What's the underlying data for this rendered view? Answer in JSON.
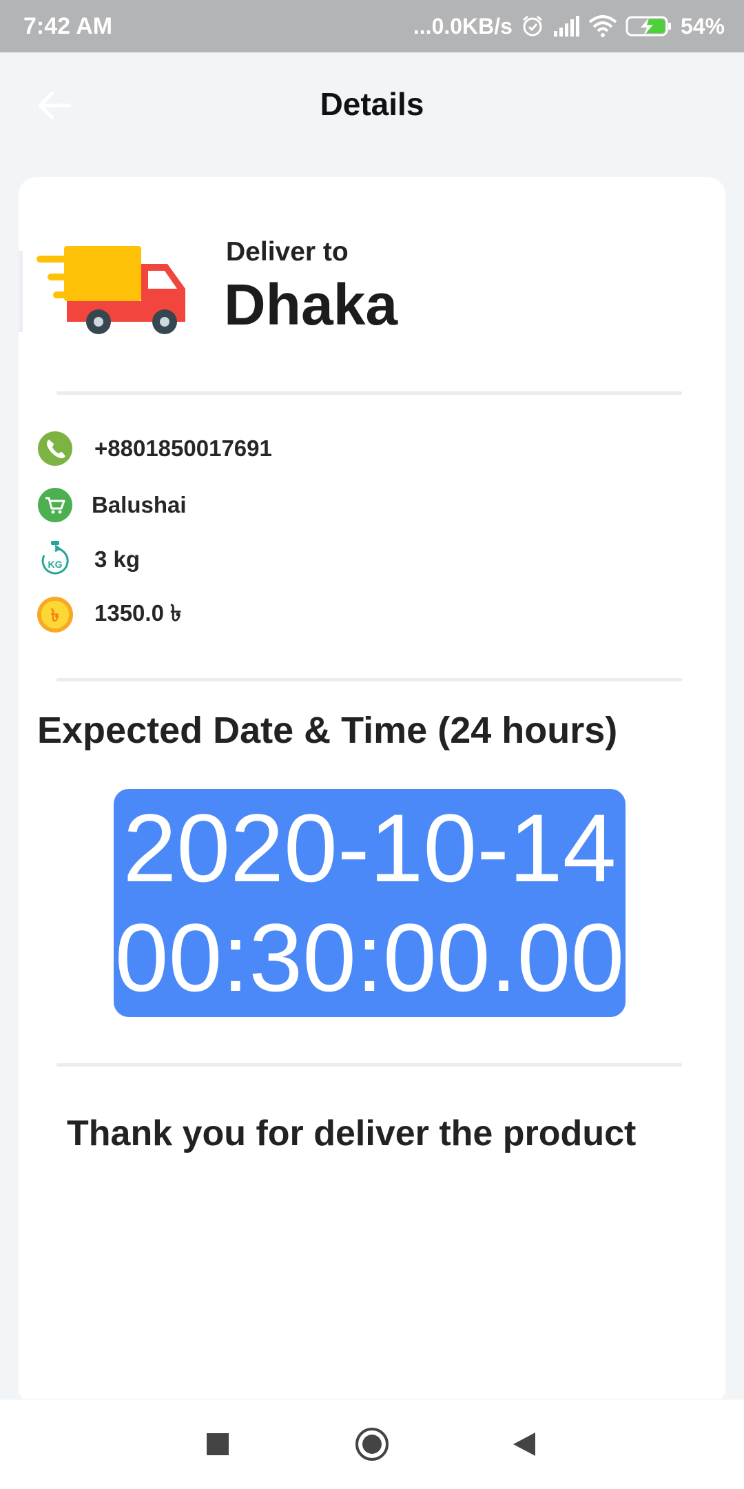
{
  "status_bar": {
    "time": "7:42 AM",
    "network_speed": "...0.0KB/s",
    "battery": "54%",
    "icons": [
      "alarm-icon",
      "signal-icon",
      "wifi-icon",
      "battery-charging-icon"
    ]
  },
  "app_bar": {
    "title": "Details",
    "back_icon": "arrow-left-icon"
  },
  "delivery": {
    "label": "Deliver to",
    "city": "Dhaka",
    "truck_icon": "delivery-truck-icon"
  },
  "details": [
    {
      "icon": "phone-icon",
      "text": "+8801850017691"
    },
    {
      "icon": "cart-icon",
      "text": "Balushai"
    },
    {
      "icon": "weight-kg-icon",
      "text": "3 kg"
    },
    {
      "icon": "taka-coin-icon",
      "text": "1350.0 ৳"
    }
  ],
  "expected": {
    "title": "Expected Date & Time (24 hours)",
    "date": "2020-10-14",
    "time": "00:30:00.00"
  },
  "thanks_text": "Thank you for deliver the product",
  "nav": {
    "icons": [
      "recents-square-icon",
      "home-circle-icon",
      "back-triangle-icon"
    ]
  },
  "colors": {
    "accent_blue": "#4a89f7",
    "truck_red": "#f2453d",
    "truck_yellow": "#ffc107",
    "phone_green": "#7cb342",
    "cart_green": "#4caf50",
    "kg_teal": "#26a69a",
    "coin_gold": "#fbc02d"
  }
}
